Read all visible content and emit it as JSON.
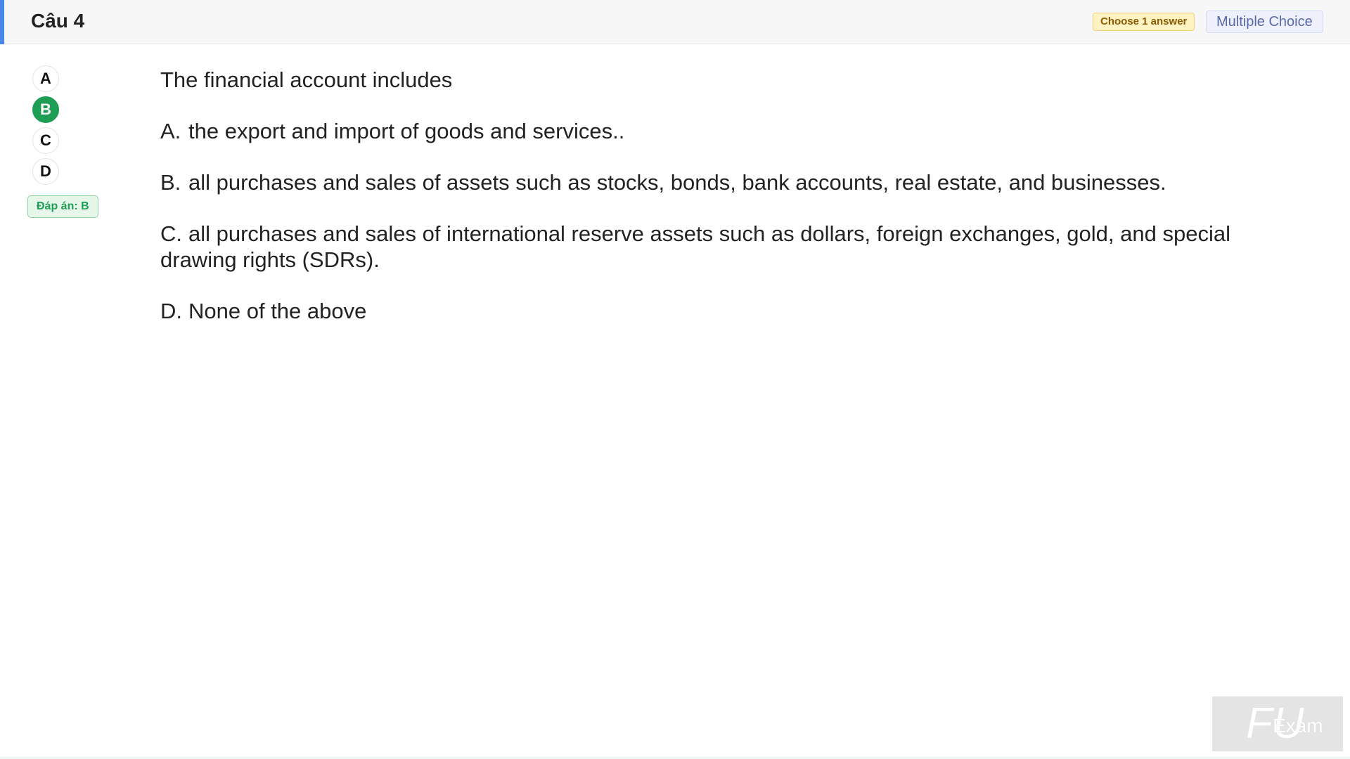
{
  "header": {
    "title": "Câu 4",
    "choose_badge": "Choose 1 answer",
    "type_badge": "Multiple Choice",
    "accent_color": "#4a86e8"
  },
  "choices": {
    "items": [
      {
        "label": "A",
        "selected": false
      },
      {
        "label": "B",
        "selected": true
      },
      {
        "label": "C",
        "selected": false
      },
      {
        "label": "D",
        "selected": false
      }
    ],
    "selected_color": "#1e9e55"
  },
  "answer": {
    "text": "Đáp án: B"
  },
  "question": {
    "stem": "The financial account includes",
    "options": [
      {
        "letter": "A.",
        "text": "the export and import of goods and services.."
      },
      {
        "letter": "B.",
        "text": "all purchases and sales of assets such as stocks, bonds, bank accounts, real estate, and businesses."
      },
      {
        "letter": "C.",
        "text": "all purchases and sales of international reserve assets such as dollars, foreign exchanges, gold, and special drawing rights (SDRs)."
      },
      {
        "letter": "D.",
        "text": "None of the above"
      }
    ]
  },
  "watermark": {
    "logo_mark": "FU",
    "logo_text": "Exam"
  }
}
